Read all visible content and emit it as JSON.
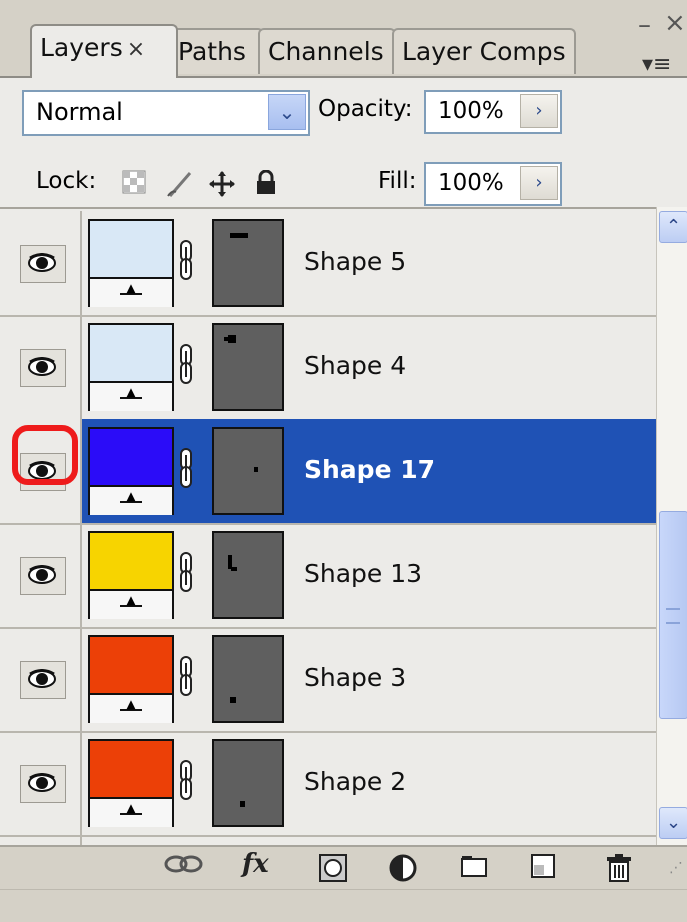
{
  "tabs": [
    {
      "label": "Layers",
      "close": "×",
      "active": true
    },
    {
      "label": "Paths",
      "active": false
    },
    {
      "label": "Channels",
      "active": false
    },
    {
      "label": "Layer Comps",
      "active": false
    }
  ],
  "window_controls": {
    "minimize": "–",
    "close": "×",
    "menu": "▾≡"
  },
  "blend_mode": {
    "value": "Normal",
    "arrow": "⌄"
  },
  "opacity": {
    "label": "Opacity:",
    "value": "100%",
    "arrow": "›"
  },
  "lock": {
    "label": "Lock:"
  },
  "fill": {
    "label": "Fill:",
    "value": "100%",
    "arrow": "›"
  },
  "layers": [
    {
      "name": "Shape 5",
      "color": "#d9e8f6",
      "selected": false
    },
    {
      "name": "Shape 4",
      "color": "#d9e8f6",
      "selected": false
    },
    {
      "name": "Shape 17",
      "color": "#2b0cf8",
      "selected": true
    },
    {
      "name": "Shape 13",
      "color": "#f7d400",
      "selected": false
    },
    {
      "name": "Shape 3",
      "color": "#ec4007",
      "selected": false
    },
    {
      "name": "Shape 2",
      "color": "#ec4007",
      "selected": false
    }
  ],
  "selection_color": "#1f52b5",
  "highlight_color": "#ee1b1b",
  "toolbar_icons": [
    "link-icon",
    "fx-icon",
    "mask-icon",
    "adjustment-icon",
    "folder-icon",
    "new-layer-icon",
    "trash-icon"
  ],
  "toolbar_fx": "fx"
}
